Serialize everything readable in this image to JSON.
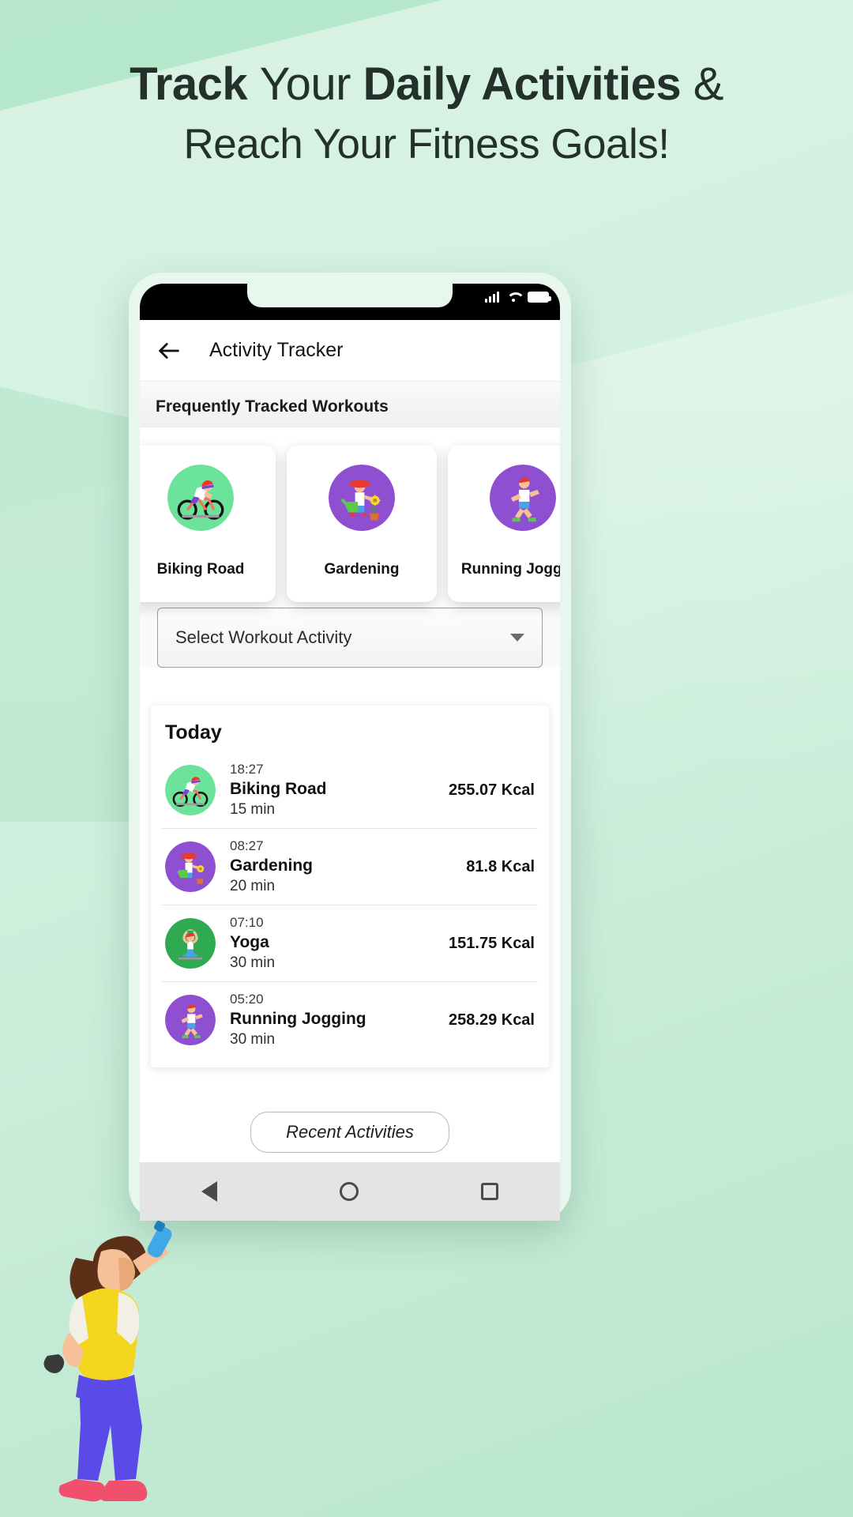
{
  "headline": {
    "line1_part1": "Track ",
    "line1_part2": "Your ",
    "line1_part3": "Daily Activities ",
    "line1_part4": "&",
    "line2": "Reach Your Fitness Goals!"
  },
  "statusbar": {
    "signal_icon": "signal-bars-icon",
    "wifi_icon": "wifi-icon",
    "battery_icon": "battery-full-icon"
  },
  "appbar": {
    "back_icon": "back-arrow-icon",
    "title": "Activity Tracker"
  },
  "section": {
    "title": "Frequently Tracked Workouts"
  },
  "workout_cards": [
    {
      "label": "Biking Road",
      "icon": "cyclist-icon",
      "circle_color": "#6ce39a"
    },
    {
      "label": "Gardening",
      "icon": "gardener-icon",
      "circle_color": "#8e4fd0"
    },
    {
      "label": "Running Jogging",
      "icon": "runner-icon",
      "circle_color": "#8e4fd0"
    }
  ],
  "dropdown": {
    "value": "Select Workout Activity",
    "caret_icon": "chevron-down-icon"
  },
  "today": {
    "title": "Today",
    "rows": [
      {
        "time": "18:27",
        "name": "Biking Road",
        "duration": "15 min",
        "kcal": "255.07 Kcal",
        "icon": "cyclist-icon",
        "circle_color": "#6ce39a"
      },
      {
        "time": "08:27",
        "name": "Gardening",
        "duration": "20 min",
        "kcal": "81.8 Kcal",
        "icon": "gardener-icon",
        "circle_color": "#8e4fd0"
      },
      {
        "time": "07:10",
        "name": "Yoga",
        "duration": "30 min",
        "kcal": "151.75 Kcal",
        "icon": "yoga-icon",
        "circle_color": "#2faa52"
      },
      {
        "time": "05:20",
        "name": "Running Jogging",
        "duration": "30 min",
        "kcal": "258.29 Kcal",
        "icon": "runner-icon",
        "circle_color": "#8e4fd0"
      }
    ]
  },
  "recent_button": {
    "label": "Recent Activities"
  },
  "navbar": {
    "back_icon": "nav-back-triangle-icon",
    "home_icon": "nav-home-circle-icon",
    "recents_icon": "nav-recents-square-icon"
  },
  "colors": {
    "background_green": "#d2f1e0",
    "accent_green": "#6ce39a",
    "accent_purple": "#8e4fd0",
    "text_dark": "#24302b"
  }
}
